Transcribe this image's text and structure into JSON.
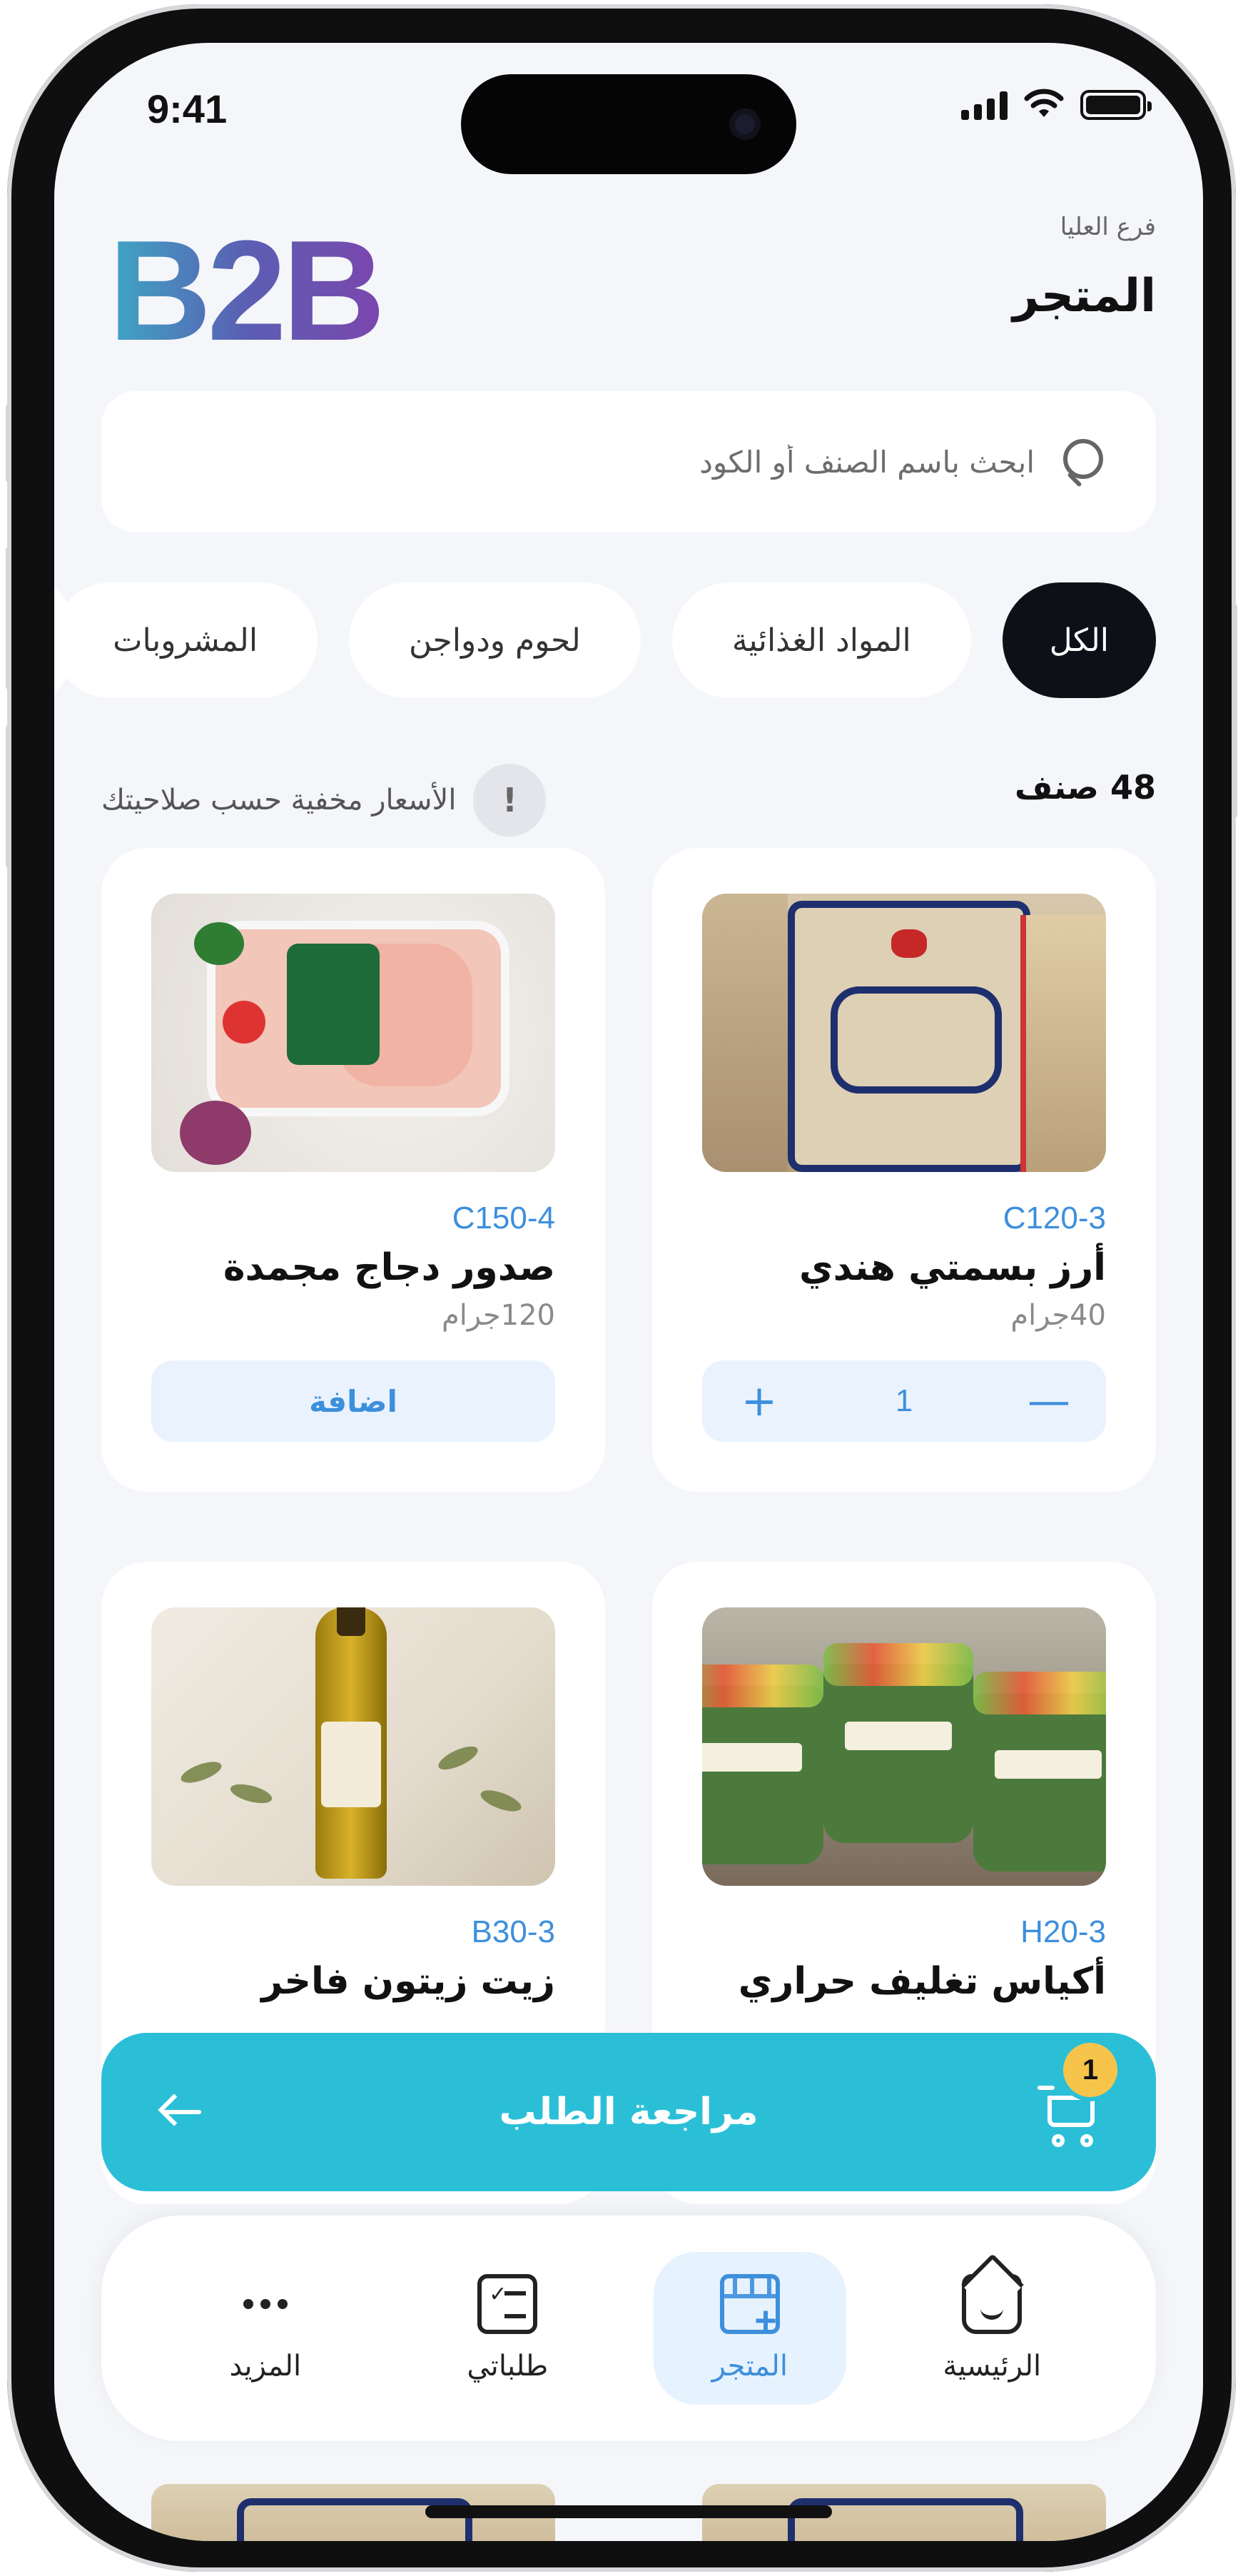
{
  "status_bar": {
    "time": "9:41"
  },
  "header": {
    "logo": "B2B",
    "branch": "فرع العليا",
    "title": "المتجر"
  },
  "search": {
    "placeholder": "ابحث باسم الصنف أو الكود"
  },
  "categories": [
    {
      "label": "الكل",
      "active": true
    },
    {
      "label": "المواد الغذائية",
      "active": false
    },
    {
      "label": "لحوم ودواجن",
      "active": false
    },
    {
      "label": "المشروبات",
      "active": false
    }
  ],
  "info": {
    "count": "48 صنف",
    "notice": "الأسعار مخفية حسب صلاحيتك",
    "notice_icon": "!"
  },
  "products": [
    {
      "code": "C120-3",
      "name": "أرز بسمتي هندي",
      "weight": "40جرام",
      "image": "rice-bag",
      "quantity": "1",
      "in_cart": true
    },
    {
      "code": "C150-4",
      "name": "صدور دجاج مجمدة",
      "weight": "120جرام",
      "image": "chicken-tray",
      "action_label": "اضافة",
      "in_cart": false
    },
    {
      "code": "H20-3",
      "name": "أكياس تغليف حراري",
      "image": "salad-bowls",
      "in_cart": false
    },
    {
      "code": "B30-3",
      "name": "زيت زيتون فاخر",
      "image": "olive-oil-bottle",
      "in_cart": false
    }
  ],
  "stepper": {
    "minus": "—",
    "plus": "+"
  },
  "cart_bar": {
    "label": "مراجعة الطلب",
    "badge": "1",
    "cart_icon": "cart-icon",
    "arrow_icon": "arrow-left-icon",
    "color": "#2bbfd7",
    "badge_color": "#f6c44b"
  },
  "bottom_nav": [
    {
      "label": "الرئيسية",
      "icon": "home-icon",
      "active": false
    },
    {
      "label": "المتجر",
      "icon": "store-icon",
      "active": true
    },
    {
      "label": "طلباتي",
      "icon": "orders-icon",
      "active": false
    },
    {
      "label": "المزيد",
      "icon": "more-icon",
      "active": false
    }
  ],
  "colors": {
    "accent": "#3d8fdc",
    "active_chip": "#0d1117",
    "background": "#f4f6fa"
  }
}
